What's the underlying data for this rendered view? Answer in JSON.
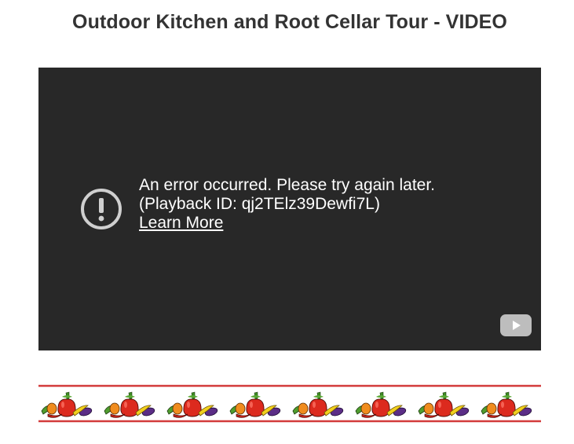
{
  "page": {
    "title": "Outdoor Kitchen and Root Cellar Tour - VIDEO"
  },
  "video": {
    "error_message": "An error occurred. Please try again later.",
    "playback_id": "(Playback ID: qj2TElz39Dewfi7L)",
    "learn_more": "Learn More",
    "error_icon": "exclamation-circle-icon",
    "logo_icon": "youtube-logo-icon",
    "background_color": "#282828"
  },
  "decoration": {
    "border_icon": "pepper-border",
    "border_line_color": "#d33b3b"
  }
}
